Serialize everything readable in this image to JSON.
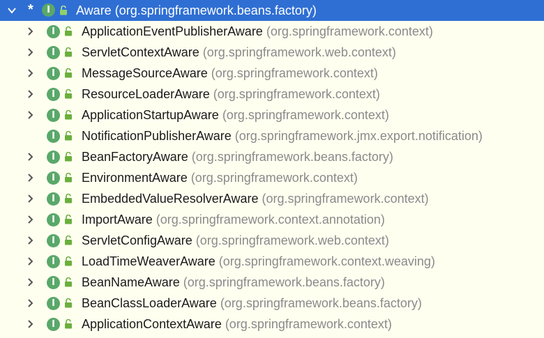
{
  "root": {
    "marker": "*",
    "icon_letter": "I",
    "name": "Aware",
    "package": "(org.springframework.beans.factory)",
    "expanded": true
  },
  "children": [
    {
      "name": "ApplicationEventPublisherAware",
      "package": "(org.springframework.context)",
      "expandable": true
    },
    {
      "name": "ServletContextAware",
      "package": "(org.springframework.web.context)",
      "expandable": true
    },
    {
      "name": "MessageSourceAware",
      "package": "(org.springframework.context)",
      "expandable": true
    },
    {
      "name": "ResourceLoaderAware",
      "package": "(org.springframework.context)",
      "expandable": true
    },
    {
      "name": "ApplicationStartupAware",
      "package": "(org.springframework.context)",
      "expandable": true
    },
    {
      "name": "NotificationPublisherAware",
      "package": "(org.springframework.jmx.export.notification)",
      "expandable": false
    },
    {
      "name": "BeanFactoryAware",
      "package": "(org.springframework.beans.factory)",
      "expandable": true
    },
    {
      "name": "EnvironmentAware",
      "package": "(org.springframework.context)",
      "expandable": true
    },
    {
      "name": "EmbeddedValueResolverAware",
      "package": "(org.springframework.context)",
      "expandable": true
    },
    {
      "name": "ImportAware",
      "package": "(org.springframework.context.annotation)",
      "expandable": true
    },
    {
      "name": "ServletConfigAware",
      "package": "(org.springframework.web.context)",
      "expandable": true
    },
    {
      "name": "LoadTimeWeaverAware",
      "package": "(org.springframework.context.weaving)",
      "expandable": true
    },
    {
      "name": "BeanNameAware",
      "package": "(org.springframework.beans.factory)",
      "expandable": true
    },
    {
      "name": "BeanClassLoaderAware",
      "package": "(org.springframework.beans.factory)",
      "expandable": true
    },
    {
      "name": "ApplicationContextAware",
      "package": "(org.springframework.context)",
      "expandable": true
    }
  ],
  "icons": {
    "interface": "interface-icon",
    "lock": "unlocked-icon",
    "expand": "chevron-right-icon",
    "collapse": "chevron-down-icon"
  },
  "colors": {
    "selection": "#2f6fd3",
    "background": "#fffff0",
    "interface_icon": "#59a869",
    "lock_icon": "#6aaf3d",
    "package_text": "#8a8a8a",
    "class_text": "#1a1a1a"
  }
}
